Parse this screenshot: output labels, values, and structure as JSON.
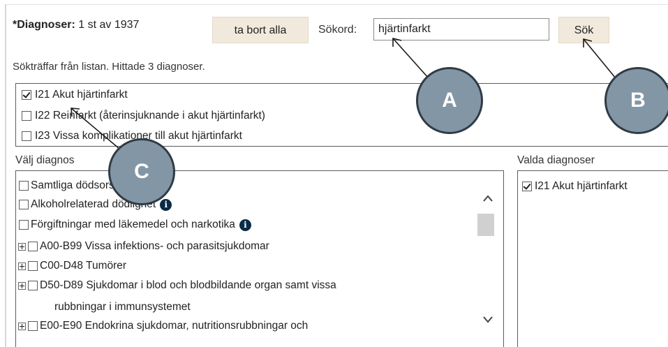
{
  "header": {
    "diagnoses_label": "*Diagnoser:",
    "diagnoses_count": "1 st av 1937",
    "remove_all_label": "ta bort alla",
    "search_label": "Sökord:",
    "search_value": "hjärtinfarkt",
    "search_button_label": "Sök"
  },
  "results_text": "Sökträffar från listan. Hittade 3 diagnoser.",
  "search_hits": [
    {
      "label": "I21 Akut hjärtinfarkt",
      "checked": true
    },
    {
      "label": "I22 Reinfarkt (återinsjuknande i akut hjärtinfarkt)",
      "checked": false
    },
    {
      "label": "I23 Vissa komplikationer till akut hjärtinfarkt",
      "checked": false
    }
  ],
  "choose_label": "Välj diagnos",
  "chosen_label": "Valda diagnoser",
  "tree_items": [
    {
      "label": "Samtliga dödsorsaker",
      "expandable": false,
      "info": false
    },
    {
      "label": "Alkoholrelaterad dödlighet",
      "expandable": false,
      "info": true
    },
    {
      "label": "Förgiftningar med läkemedel och narkotika",
      "expandable": false,
      "info": true
    },
    {
      "label": "A00-B99 Vissa infektions- och parasitsjukdomar",
      "expandable": true,
      "info": false
    },
    {
      "label": "C00-D48 Tumörer",
      "expandable": true,
      "info": false
    },
    {
      "label": "D50-D89 Sjukdomar i blod och blodbildande organ samt vissa",
      "expandable": true,
      "info": false
    },
    {
      "label": "E00-E90 Endokrina sjukdomar, nutritionsrubbningar och",
      "expandable": true,
      "info": false
    }
  ],
  "tree_wrap_lines": [
    "rubbningar i immunsystemet"
  ],
  "chosen_items": [
    {
      "label": "I21 Akut hjärtinfarkt",
      "checked": true
    }
  ],
  "callouts": {
    "a": "A",
    "b": "B",
    "c": "C"
  },
  "icons": {
    "info": "info-icon",
    "expand": "plus-expand-icon",
    "scroll_up": "chevron-up-icon",
    "scroll_down": "chevron-down-icon"
  },
  "colors": {
    "button_bg": "#f1eadc",
    "callout_fill": "#8396a6",
    "callout_border": "#2f3b45",
    "info_icon": "#0b2a45"
  }
}
